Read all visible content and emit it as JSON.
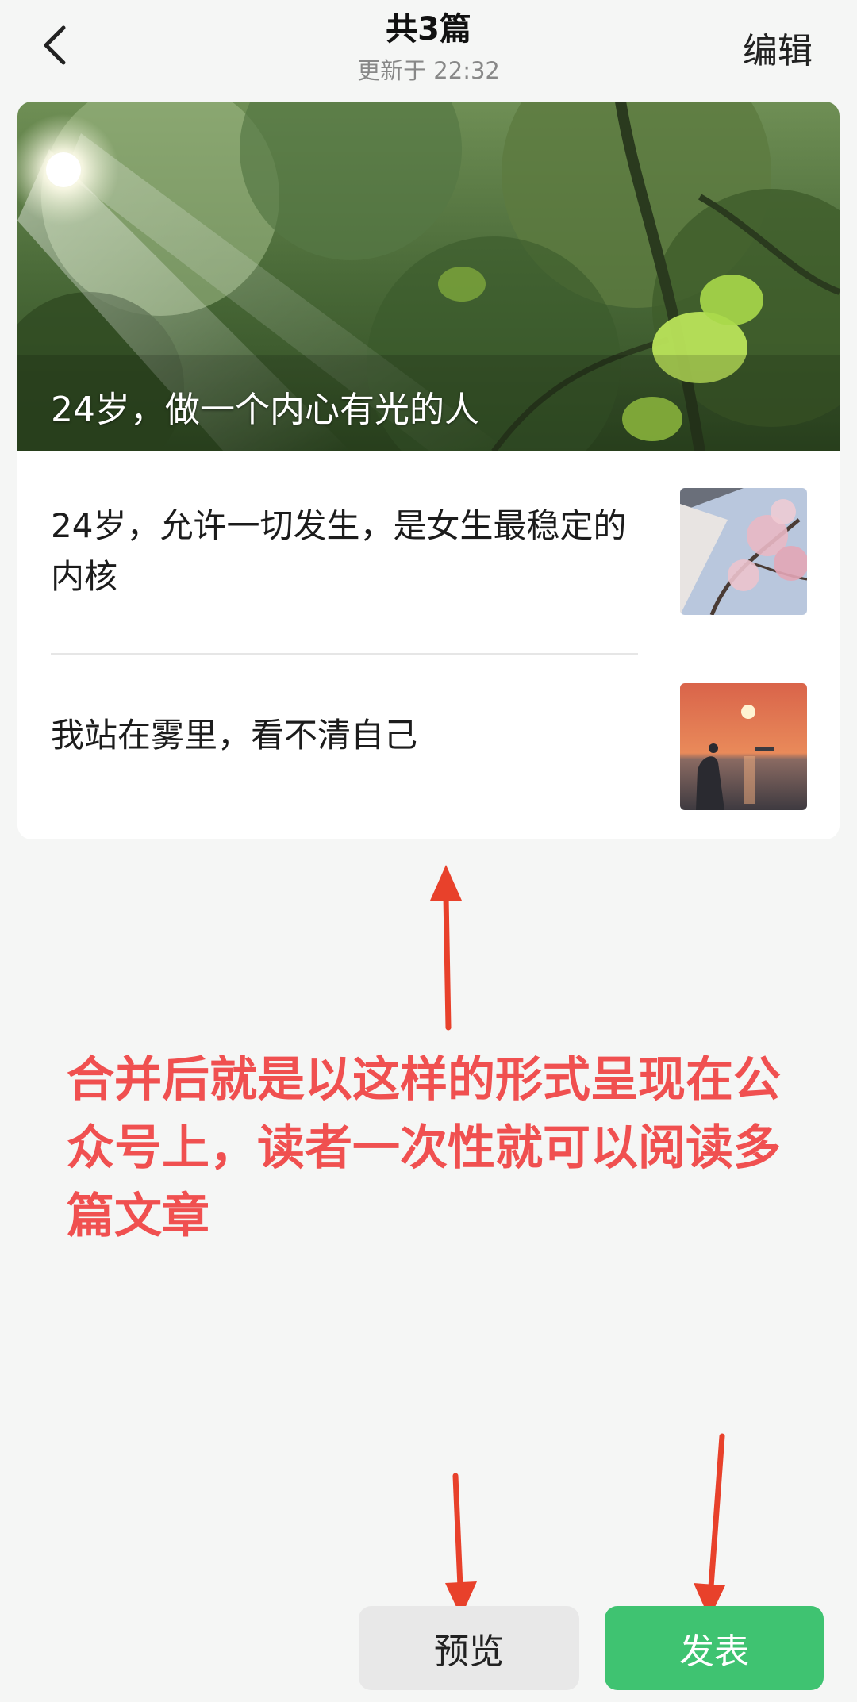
{
  "header": {
    "title": "共3篇",
    "subtitle": "更新于 22:32",
    "edit_label": "编辑",
    "back_icon": "chevron-left-icon"
  },
  "articles": [
    {
      "title": "24岁，做一个内心有光的人"
    },
    {
      "title": "24岁，允许一切发生，是女生最稳定的内核"
    },
    {
      "title": "我站在雾里，看不清自己"
    }
  ],
  "annotation": {
    "text": "合并后就是以这样的形式呈现在公众号上，读者一次性就可以阅读多篇文章",
    "color": "#f05050"
  },
  "buttons": {
    "preview_label": "预览",
    "publish_label": "发表"
  },
  "colors": {
    "accent": "#3fc371",
    "arrow": "#e8412b"
  }
}
